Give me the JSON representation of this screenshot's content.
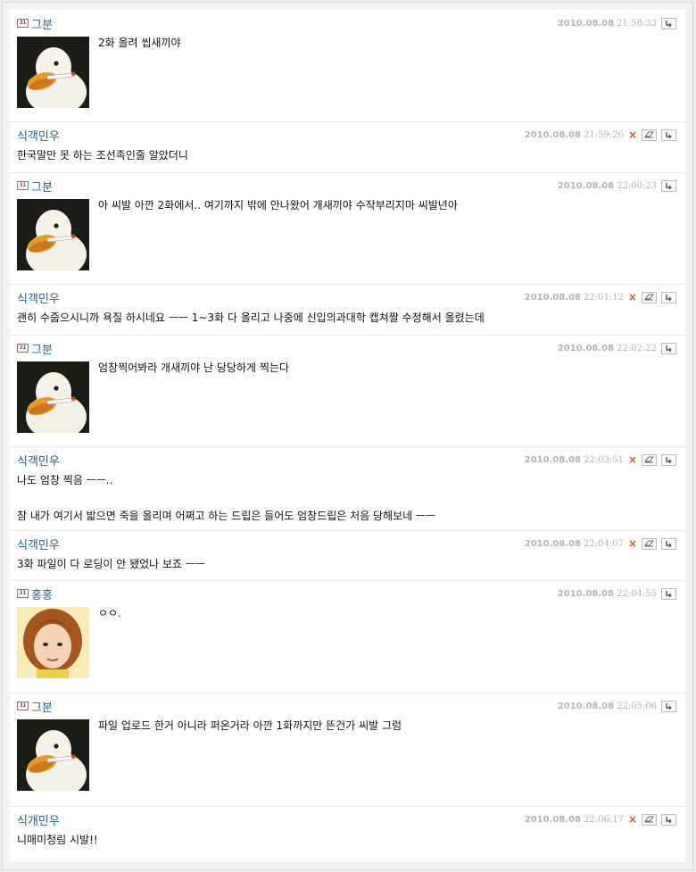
{
  "comments": [
    {
      "author": "그분",
      "level_icon": "31",
      "date": "2010.08.08",
      "time": "21:58:33",
      "avatar": "duck-avatar",
      "deletable": false,
      "lines": [
        "2화 올려 씹새끼야"
      ]
    },
    {
      "author": "식객민우",
      "level_icon": "",
      "date": "2010.08.08",
      "time": "21:59:26",
      "avatar": "",
      "deletable": true,
      "lines": [
        "한국말만 못 하는 조선족인줄 알았더니"
      ]
    },
    {
      "author": "그분",
      "level_icon": "31",
      "date": "2010.08.08",
      "time": "22:00:23",
      "avatar": "duck-avatar",
      "deletable": false,
      "lines": [
        "아 씨발 아깐 2화에서.. 여기까지 밖에 안나왔어 개새끼야 수작부리지마 씨발년아"
      ]
    },
    {
      "author": "식객민우",
      "level_icon": "",
      "date": "2010.08.08",
      "time": "22:01:12",
      "avatar": "",
      "deletable": true,
      "lines": [
        "괜히 수줍으시니까 욕질 하시네요 ㅡㅡ 1~3화 다 올리고 나중에 신입의과대학 캡쳐짤 수정해서 올렸는데"
      ]
    },
    {
      "author": "그분",
      "level_icon": "31",
      "date": "2010.08.08",
      "time": "22:02:22",
      "avatar": "duck-avatar",
      "deletable": false,
      "lines": [
        "엄창찍어봐라 개새끼야 난 당당하게 찍는다"
      ]
    },
    {
      "author": "식객민우",
      "level_icon": "",
      "date": "2010.08.08",
      "time": "22:03:51",
      "avatar": "",
      "deletable": true,
      "lines": [
        "나도 엄창 찍음 ㅡㅡ..",
        "",
        "참 내가 여기서 밟으면 죽을 올리며 어쩌고 하는 드립은 들어도 엄창드립은 처음 당해보네 ㅡㅡ"
      ]
    },
    {
      "author": "식객민우",
      "level_icon": "",
      "date": "2010.08.08",
      "time": "22:04:07",
      "avatar": "",
      "deletable": true,
      "lines": [
        "3화 파일이 다 로딩이 안 됐었나 보죠 ㅡㅡ"
      ]
    },
    {
      "author": "홍홍",
      "level_icon": "31",
      "date": "2010.08.08",
      "time": "22:04:55",
      "avatar": "girl-avatar",
      "deletable": false,
      "lines": [
        "ㅇㅇ."
      ]
    },
    {
      "author": "그분",
      "level_icon": "31",
      "date": "2010.08.08",
      "time": "22:05:06",
      "avatar": "duck-avatar",
      "deletable": false,
      "lines": [
        "파일 업로드 한거 아니라 퍼온거라 아깐 1화까지만 뜬건가 씨발 그럼"
      ]
    },
    {
      "author": "식개민우",
      "level_icon": "",
      "date": "2010.08.08",
      "time": "22:06:17",
      "avatar": "",
      "deletable": true,
      "lines": [
        "니매미청림 시발!!"
      ]
    }
  ],
  "icons": {
    "edit": "eraser-icon",
    "reply": "reply-arrow-icon",
    "delete": "delete-x-icon"
  },
  "colors": {
    "author": "#2b5f8a",
    "date": "#b5b5b5",
    "delete": "#d9531e"
  }
}
